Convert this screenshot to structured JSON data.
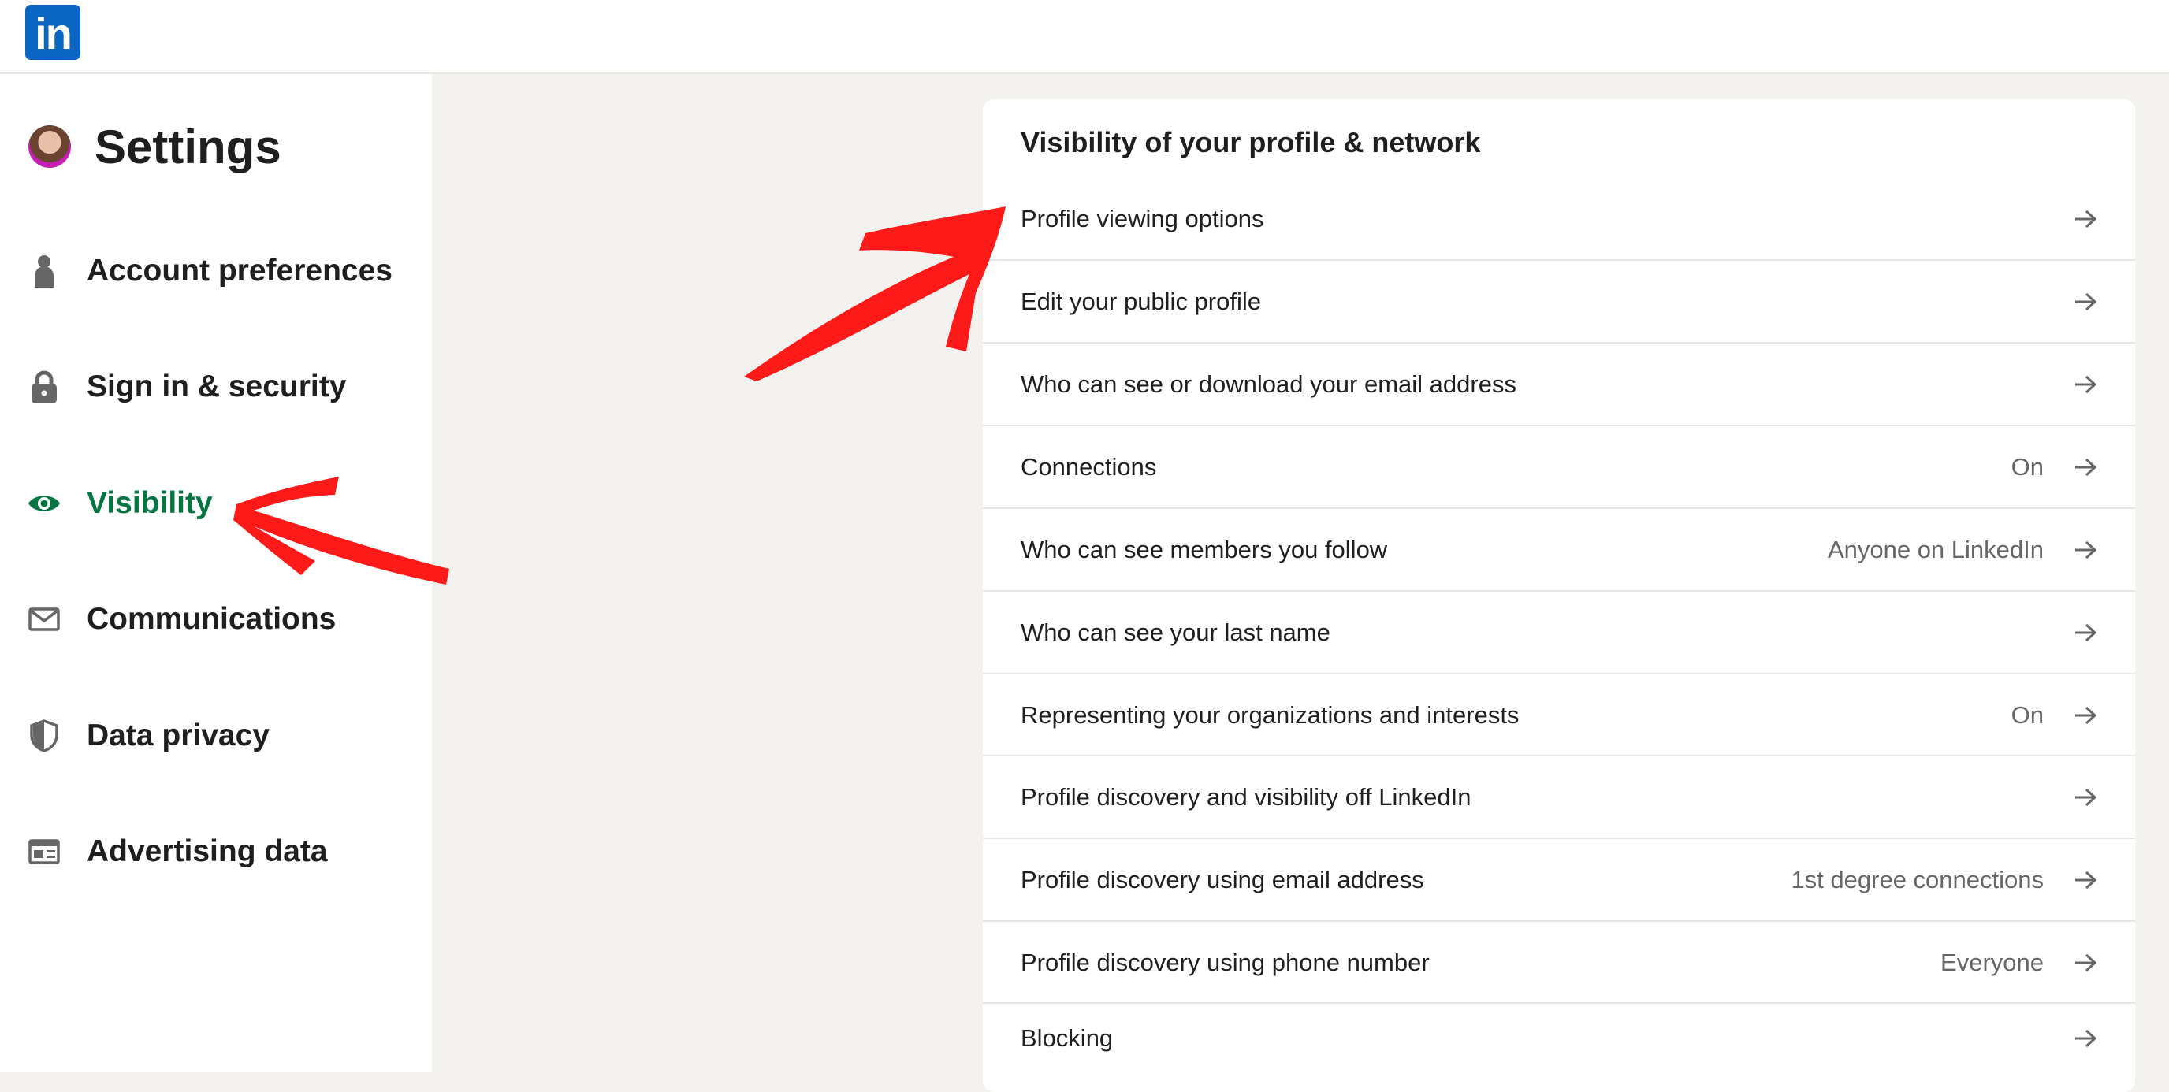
{
  "brand": {
    "logo_text": "in",
    "color": "#0a66c2"
  },
  "sidebar": {
    "title": "Settings",
    "items": [
      {
        "label": "Account preferences",
        "icon": "person-icon",
        "active": false
      },
      {
        "label": "Sign in & security",
        "icon": "lock-icon",
        "active": false
      },
      {
        "label": "Visibility",
        "icon": "eye-icon",
        "active": true
      },
      {
        "label": "Communications",
        "icon": "envelope-icon",
        "active": false
      },
      {
        "label": "Data privacy",
        "icon": "shield-icon",
        "active": false
      },
      {
        "label": "Advertising data",
        "icon": "ad-card-icon",
        "active": false
      }
    ],
    "active_color": "#057642"
  },
  "main": {
    "section_title": "Visibility of your profile & network",
    "rows": [
      {
        "label": "Profile viewing options",
        "value": ""
      },
      {
        "label": "Edit your public profile",
        "value": ""
      },
      {
        "label": "Who can see or download your email address",
        "value": ""
      },
      {
        "label": "Connections",
        "value": "On"
      },
      {
        "label": "Who can see members you follow",
        "value": "Anyone on LinkedIn"
      },
      {
        "label": "Who can see your last name",
        "value": ""
      },
      {
        "label": "Representing your organizations and interests",
        "value": "On"
      },
      {
        "label": "Profile discovery and visibility off LinkedIn",
        "value": ""
      },
      {
        "label": "Profile discovery using email address",
        "value": "1st degree connections"
      },
      {
        "label": "Profile discovery using phone number",
        "value": "Everyone"
      },
      {
        "label": "Blocking",
        "value": ""
      }
    ]
  },
  "annotations": {
    "arrow_color": "#ff1a1a"
  }
}
